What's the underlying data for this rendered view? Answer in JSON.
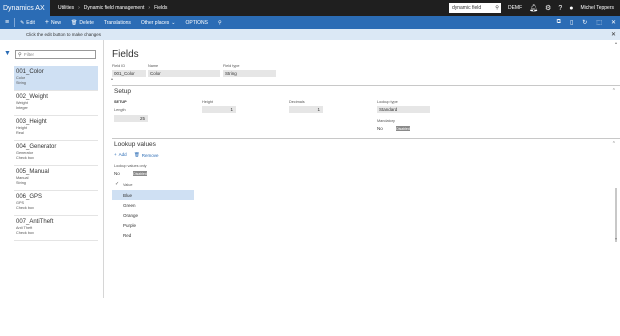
{
  "app": {
    "title": "Dynamics AX"
  },
  "breadcrumb": [
    "Utilities",
    "Dynamic field management",
    "Fields"
  ],
  "topbar": {
    "search_value": "dynamic field",
    "company": "DEMF",
    "user": "Michel Teppers"
  },
  "actionbar": {
    "edit": "Edit",
    "new": "New",
    "delete": "Delete",
    "translations": "Translations",
    "other_places": "Other places",
    "options": "OPTIONS"
  },
  "message": "Click the edit button to make changes",
  "filter": {
    "placeholder": "Filter"
  },
  "list": [
    {
      "title": "001_Color",
      "line1": "Color",
      "line2": "String"
    },
    {
      "title": "002_Weight",
      "line1": "Weight",
      "line2": "Integer"
    },
    {
      "title": "003_Height",
      "line1": "Height",
      "line2": "Real"
    },
    {
      "title": "004_Generator",
      "line1": "Generator",
      "line2": "Check box"
    },
    {
      "title": "005_Manual",
      "line1": "Manual",
      "line2": "String"
    },
    {
      "title": "006_GPS",
      "line1": "GPS",
      "line2": "Check box"
    },
    {
      "title": "007_AntiTheft",
      "line1": "Anti Theft",
      "line2": "Check box"
    }
  ],
  "details": {
    "page_title": "Fields",
    "field_id_label": "Field ID",
    "field_id": "001_Color",
    "name_label": "Name",
    "name": "Color",
    "field_type_label": "Field type",
    "field_type": "String"
  },
  "setup": {
    "header": "Setup",
    "sub": "SETUP",
    "length_label": "Length",
    "length": "25",
    "height_label": "Height",
    "height": "1",
    "decimals_label": "Decimals",
    "decimals": "1",
    "lookup_type_label": "Lookup type",
    "lookup_type": "Standard",
    "mandatory_label": "Mandatory",
    "mandatory_value": "No",
    "mandatory_toggle": "Disabled"
  },
  "lookup": {
    "header": "Lookup values",
    "add": "Add",
    "remove": "Remove",
    "only_label": "Lookup values only",
    "only_value": "No",
    "only_toggle": "Disabled",
    "col_value": "Value",
    "values": [
      "Blue",
      "Green",
      "Orange",
      "Purple",
      "Red"
    ]
  }
}
